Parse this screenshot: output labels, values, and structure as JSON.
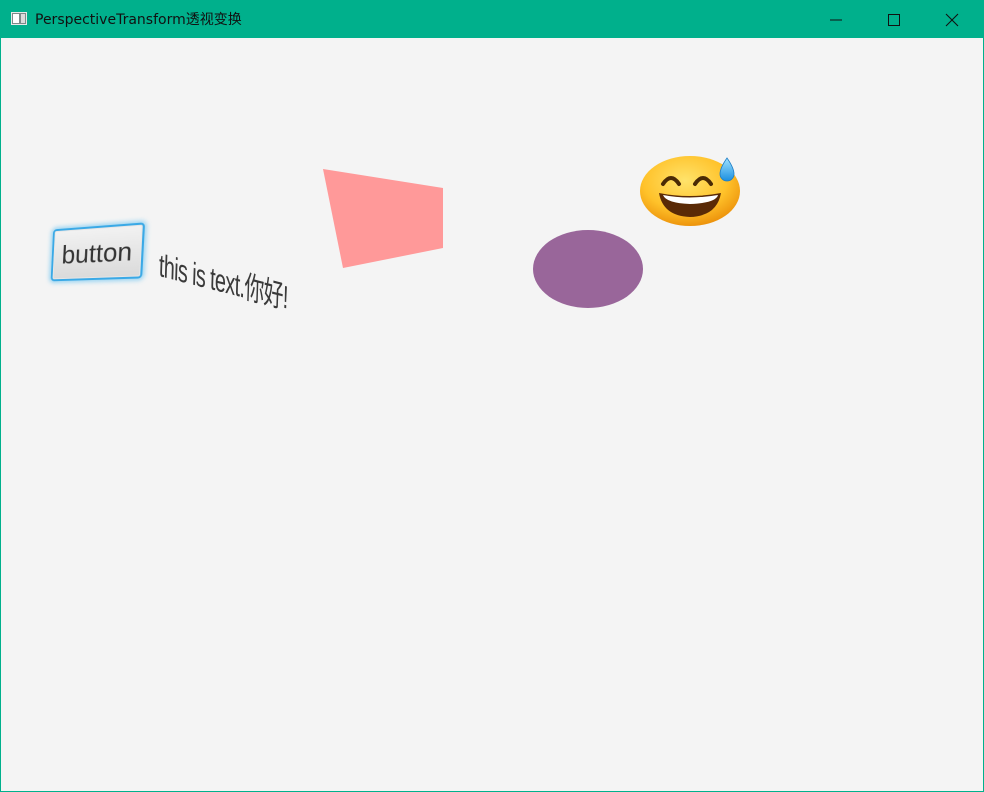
{
  "window": {
    "title": "PerspectiveTransform透视变换",
    "accent_color": "#00b08c",
    "controls": [
      "minimize-icon",
      "maximize-icon",
      "close-icon"
    ]
  },
  "scene": {
    "button_label": "button",
    "text_label": "this is text.你好!",
    "colors": {
      "polygon": "#ff9999",
      "ellipse": "#99669a",
      "button_border": "#3aa9e6"
    },
    "emoji_icon": "grinning-face-with-sweat-icon"
  }
}
